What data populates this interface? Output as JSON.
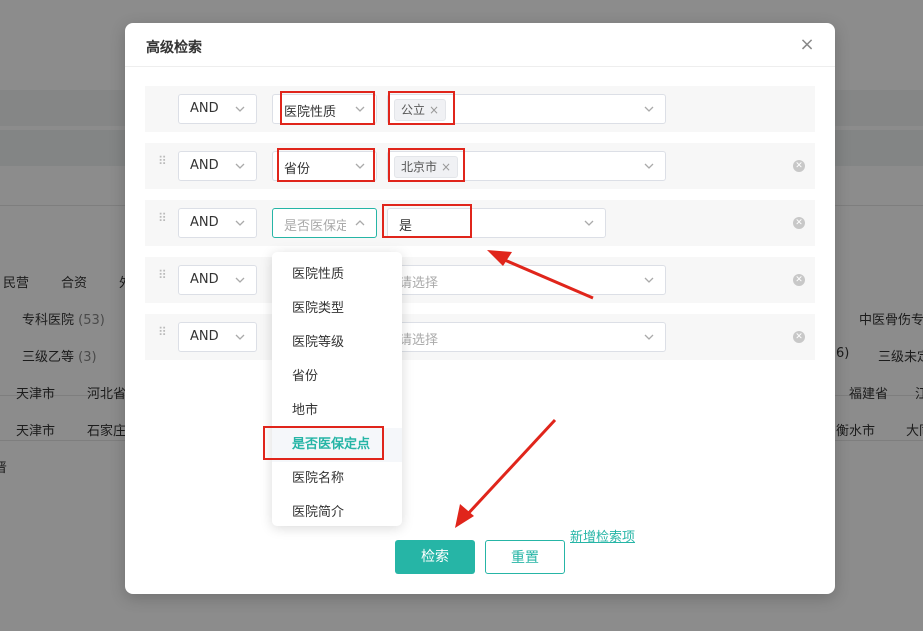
{
  "background": {
    "row1": [
      "民营",
      "合资",
      "外"
    ],
    "row2": [
      "专科医院",
      "(53)",
      "中医骨伤专"
    ],
    "row3": [
      "三级乙等",
      "(3)",
      "6)",
      "三级未定"
    ],
    "row4": [
      "天津市",
      "河北省",
      "福建省",
      "江"
    ],
    "row5": [
      "天津市",
      "石家庄",
      "衡水市",
      "大同"
    ],
    "row6": [
      "晋"
    ]
  },
  "modal": {
    "title": "高级检索",
    "close": "×",
    "rows": [
      {
        "logic": "AND",
        "field": "医院性质",
        "value_tag": "公立",
        "tag_close": "×"
      },
      {
        "logic": "AND",
        "field": "省份",
        "value_tag": "北京市",
        "tag_close": "×"
      },
      {
        "logic": "AND",
        "field": "是否医保定点",
        "value": "是"
      },
      {
        "logic": "AND",
        "field": "",
        "value_placeholder": "请选择"
      },
      {
        "logic": "AND",
        "field": "",
        "value_placeholder": "请选择"
      }
    ],
    "dropdown": [
      "医院性质",
      "医院类型",
      "医院等级",
      "省份",
      "地市",
      "是否医保定点",
      "医院名称",
      "医院简介"
    ],
    "add_link": "新增检索项",
    "search_button": "检索",
    "reset_button": "重置"
  },
  "colors": {
    "accent": "#26b5a6",
    "highlight": "#e0251b"
  }
}
